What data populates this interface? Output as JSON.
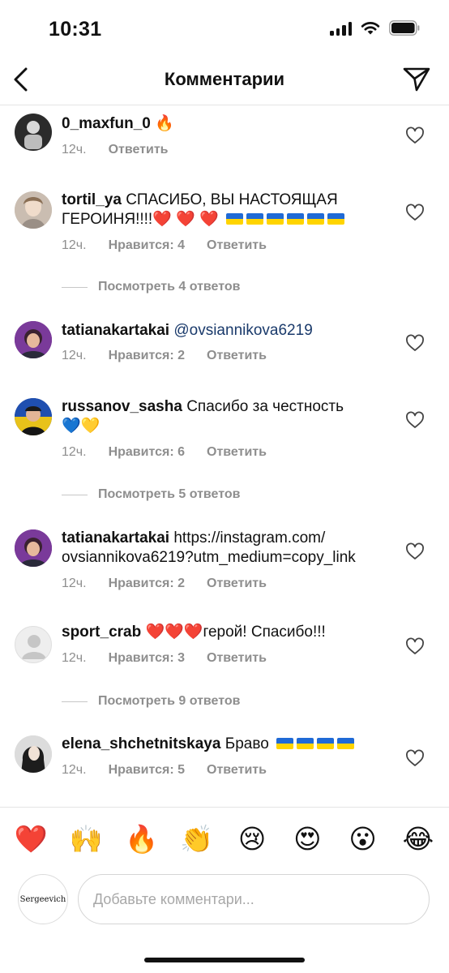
{
  "status": {
    "time": "10:31"
  },
  "header": {
    "title": "Комментарии"
  },
  "comments": [
    {
      "user": "0_maxfun_0",
      "text": "🔥",
      "time": "12ч.",
      "likes": "",
      "reply": "Ответить"
    },
    {
      "user": "tortil_ya",
      "text": "СПАСИБО, ВЫ НАСТОЯЩАЯ ГЕРОИНЯ!!!!",
      "flags": 6,
      "time": "12ч.",
      "likes": "Нравится: 4",
      "reply": "Ответить"
    },
    {
      "user": "tatianakartakai",
      "mention": "@ovsiannikova6219",
      "time": "12ч.",
      "likes": "Нравится: 2",
      "reply": "Ответить"
    },
    {
      "user": "russanov_sasha",
      "text": "Спасибо за честность",
      "time": "12ч.",
      "likes": "Нравится: 6",
      "reply": "Ответить"
    },
    {
      "user": "tatianakartakai",
      "text": "https://instagram.com/ ovsiannikova6219?utm_medium=copy_link",
      "time": "12ч.",
      "likes": "Нравится: 2",
      "reply": "Ответить"
    },
    {
      "user": "sport_crab",
      "text": "герой! Спасибо!!!",
      "time": "12ч.",
      "likes": "Нравится: 3",
      "reply": "Ответить"
    },
    {
      "user": "elena_shchetnitskaya",
      "text": "Браво",
      "flags": 4,
      "time": "12ч.",
      "likes": "Нравится: 5",
      "reply": "Ответить"
    }
  ],
  "view_replies": [
    "Посмотреть 4 ответов",
    "Посмотреть 5 ответов",
    "Посмотреть 9 ответов"
  ],
  "reactions": [
    "❤️",
    "🙌",
    "🔥",
    "👏",
    "😢",
    "😍",
    "😮",
    "😂"
  ],
  "compose": {
    "placeholder": "Добавьте комментари...",
    "avatar_text": "Sergeevich"
  },
  "colors": {
    "mention": "#1a3a6b",
    "meta": "#8e8e8e",
    "heart": "#e0142c",
    "flag_blue": "#1f6ad6",
    "flag_yellow": "#ffd400"
  }
}
